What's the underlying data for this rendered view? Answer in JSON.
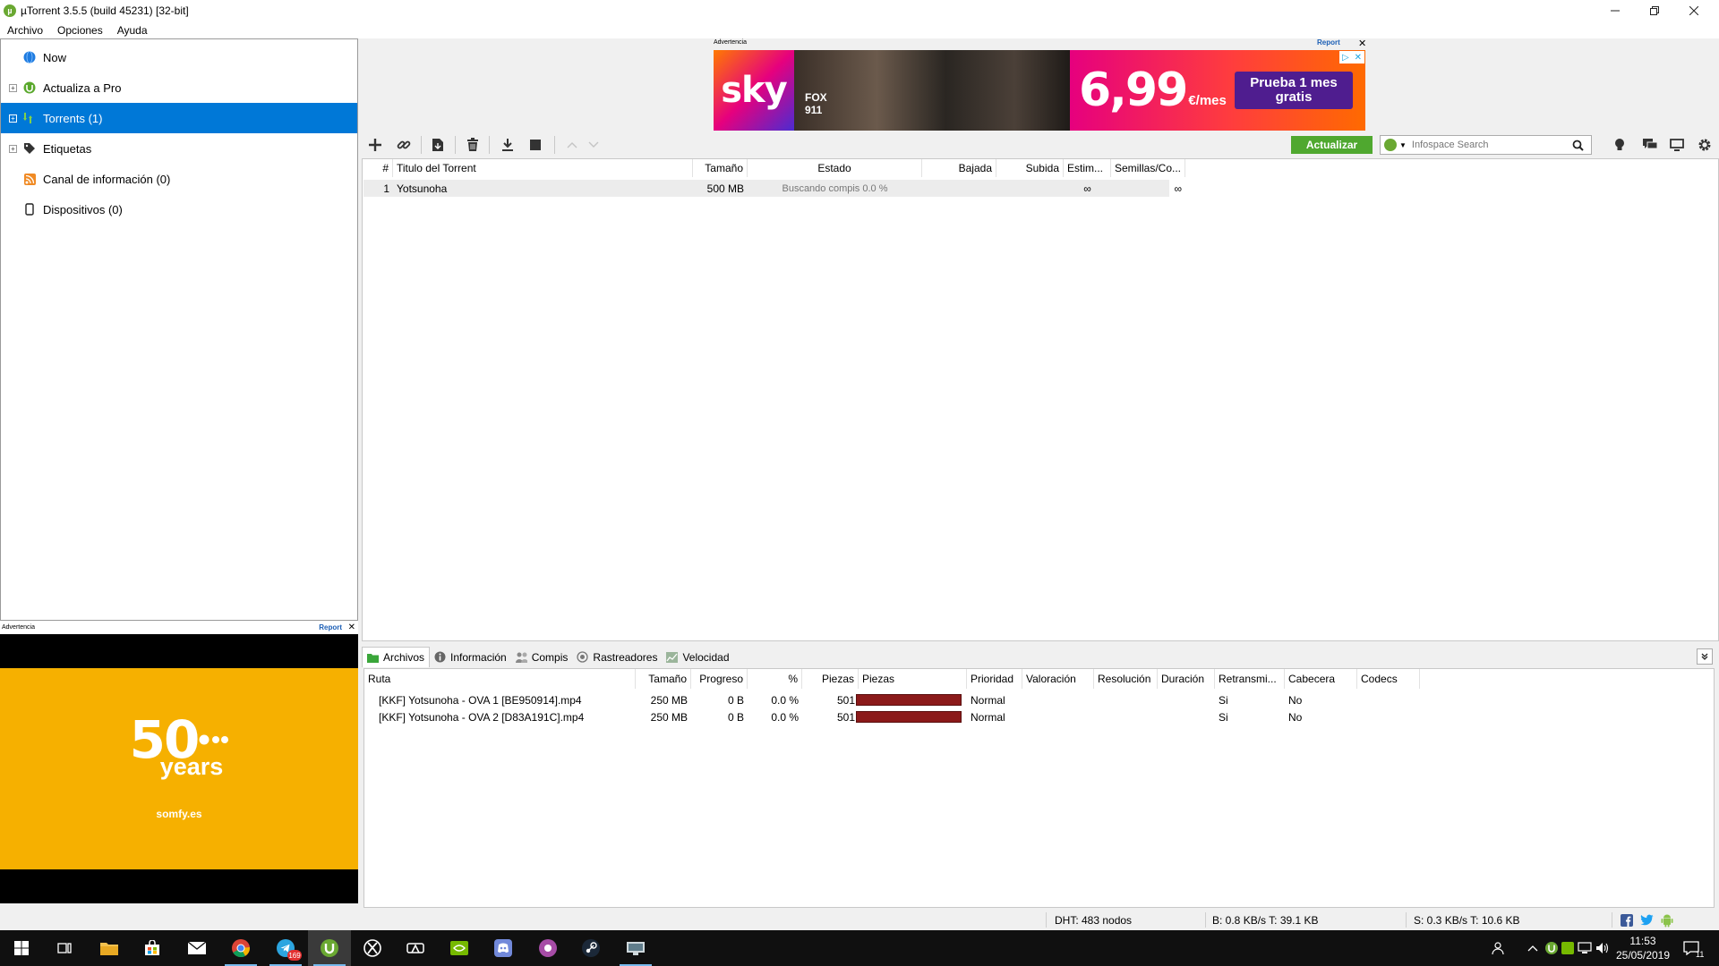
{
  "window": {
    "title": "µTorrent 3.5.5  (build 45231) [32-bit]",
    "controls": [
      "minimize",
      "restore",
      "close"
    ]
  },
  "menu": [
    "Archivo",
    "Opciones",
    "Ayuda"
  ],
  "sidebar": {
    "items": [
      {
        "label": "Now",
        "icon": "globe-icon",
        "expander": false
      },
      {
        "label": "Actualiza a Pro",
        "icon": "utorrent-icon",
        "expander": true
      },
      {
        "label": "Torrents (1)",
        "icon": "torrents-icon",
        "expander": true,
        "selected": true
      },
      {
        "label": "Etiquetas",
        "icon": "tag-icon",
        "expander": true
      },
      {
        "label": "Canal de información (0)",
        "icon": "rss-icon",
        "expander": false
      },
      {
        "label": "Dispositivos (0)",
        "icon": "device-icon",
        "expander": false
      }
    ]
  },
  "left_ad": {
    "label": "Advertencia",
    "report": "Report",
    "close": "✕",
    "brand_number": "50",
    "brand_word": "years",
    "brand_url": "somfy.es",
    "accent": "#f6b000"
  },
  "top_ad": {
    "label": "Advertencia",
    "report": "Report",
    "close": "✕",
    "logo": "sky",
    "channel": "FOX",
    "show": "911",
    "price": "6,99",
    "price_unit": "€/mes",
    "cta": "Prueba 1 mes gratis"
  },
  "toolbar": {
    "update_label": "Actualizar",
    "search_placeholder": "Infospace Search",
    "buttons": [
      "add-torrent-icon",
      "add-link-icon",
      "create-torrent-icon",
      "remove-icon",
      "start-download-icon",
      "stop-icon",
      "move-up-icon",
      "move-down-icon"
    ],
    "right_icons": [
      "lightbulb-icon",
      "chat-icon",
      "remote-icon",
      "settings-icon"
    ]
  },
  "torrents": {
    "columns": [
      "#",
      "Titulo del Torrent",
      "Tamaño",
      "Estado",
      "Bajada",
      "Subida",
      "Estim...",
      "Semillas/Co..."
    ],
    "rows": [
      {
        "num": "1",
        "title": "Yotsunoha",
        "size": "500 MB",
        "status": "Buscando compis 0.0 %",
        "down": "",
        "up": "",
        "eta": "∞",
        "seeds": "∞"
      }
    ]
  },
  "tabs": [
    {
      "label": "Archivos",
      "icon": "files-icon",
      "active": true
    },
    {
      "label": "Información",
      "icon": "info-icon"
    },
    {
      "label": "Compis",
      "icon": "peers-icon"
    },
    {
      "label": "Rastreadores",
      "icon": "trackers-icon"
    },
    {
      "label": "Velocidad",
      "icon": "speed-icon"
    }
  ],
  "files": {
    "columns": [
      "Ruta",
      "Tamaño",
      "Progreso",
      "%",
      "Piezas",
      "Piezas",
      "Prioridad",
      "Valoración",
      "Resolución",
      "Duración",
      "Retransmi...",
      "Cabecera",
      "Codecs"
    ],
    "rows": [
      {
        "path": "[KKF] Yotsunoha - OVA 1 [BE950914].mp4",
        "size": "250 MB",
        "progress": "0 B",
        "pct": "0.0 %",
        "pieces": "501",
        "priority": "Normal",
        "stream": "Si",
        "header": "No"
      },
      {
        "path": "[KKF] Yotsunoha - OVA 2 [D83A191C].mp4",
        "size": "250 MB",
        "progress": "0 B",
        "pct": "0.0 %",
        "pieces": "501",
        "priority": "Normal",
        "stream": "Si",
        "header": "No"
      }
    ],
    "pieces_color": "#8b1a1a"
  },
  "status": {
    "dht": "DHT: 483 nodos",
    "down": "B: 0.8 KB/s T: 39.1 KB",
    "up": "S: 0.3 KB/s T: 10.6 KB"
  },
  "taskbar": {
    "apps": [
      "start-icon",
      "task-view-icon",
      "file-explorer-icon",
      "store-icon",
      "mail-icon",
      "chrome-icon",
      "telegram-icon",
      "utorrent-icon",
      "xbox-icon",
      "game-icon",
      "nvidia-icon",
      "discord-icon",
      "app-icon",
      "steam-icon",
      "network-app-icon"
    ],
    "telegram_badge": "169",
    "time": "11:53",
    "date": "25/05/2019",
    "notifications": "11"
  }
}
